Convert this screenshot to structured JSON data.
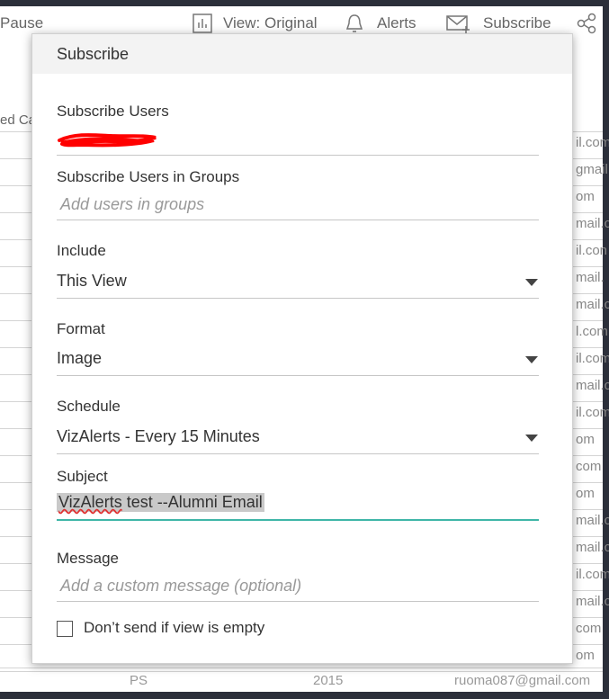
{
  "toolbar": {
    "pause_label": "Pause",
    "view_label": "View: Original",
    "alerts_label": "Alerts",
    "subscribe_label": "Subscribe",
    "share_icon": "share-icon"
  },
  "background": {
    "column_header_fragment": "ed Ca",
    "right_cells": [
      "il.com",
      "gmail.",
      "om",
      "mail.c",
      "il.con",
      "mail.",
      "mail.c",
      "l.com",
      "il.com",
      "mail.c",
      "il.com",
      "om",
      "com",
      "om",
      "mail.c",
      "mail.c",
      "il.com",
      "mail.c",
      "com",
      "om"
    ],
    "bottom_row": {
      "col1": "PS",
      "col2": "2015",
      "col3": "ruoma087@gmail.com"
    }
  },
  "dialog": {
    "title": "Subscribe",
    "subscribe_users": {
      "label": "Subscribe Users"
    },
    "groups": {
      "label": "Subscribe Users in Groups",
      "placeholder": "Add users in groups"
    },
    "include": {
      "label": "Include",
      "value": "This View"
    },
    "format": {
      "label": "Format",
      "value": "Image"
    },
    "schedule": {
      "label": "Schedule",
      "value": "VizAlerts - Every 15 Minutes"
    },
    "subject": {
      "label": "Subject",
      "value_part1": "VizAlerts",
      "value_part2": " test --Alumni Email"
    },
    "message": {
      "label": "Message",
      "placeholder": "Add a custom message (optional)"
    },
    "dont_send": {
      "label": "Don’t send if view is empty",
      "checked": false
    }
  },
  "colors": {
    "frame": "#2b2f3a",
    "focus_underline": "#3fb6a8",
    "redaction": "#ff0000",
    "dialog_header_bg": "#f3f3f3"
  }
}
